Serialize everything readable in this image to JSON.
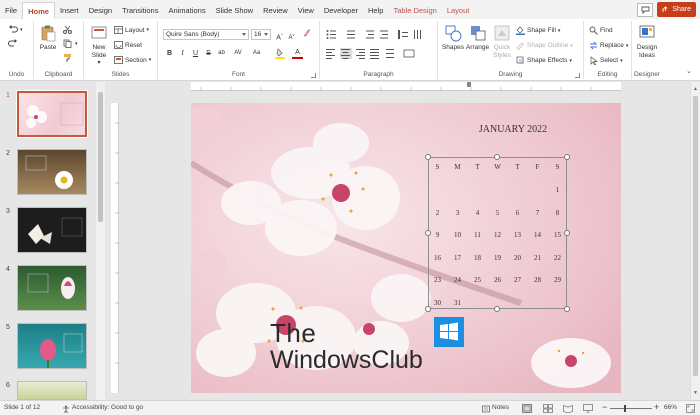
{
  "menu": {
    "tabs": [
      "File",
      "Home",
      "Insert",
      "Design",
      "Transitions",
      "Animations",
      "Slide Show",
      "Review",
      "View",
      "Developer",
      "Help"
    ],
    "context_tabs": [
      "Table Design",
      "Layout"
    ],
    "share": "Share"
  },
  "ribbon": {
    "undo_label": "Undo",
    "clipboard": {
      "label": "Clipboard",
      "paste": "Paste"
    },
    "slides": {
      "label": "Slides",
      "new_slide": "New Slide",
      "new_slide_arrow": "▾",
      "layout": "Layout",
      "reset": "Reset",
      "section": "Section"
    },
    "font": {
      "label": "Font",
      "family": "Quire Sans (Body)",
      "size": "16",
      "bold": "B",
      "italic": "I",
      "underline": "U",
      "strike": "S",
      "shadow": "ab",
      "spacing": "AV",
      "case": "Aa",
      "color_letter": "A"
    },
    "paragraph": {
      "label": "Paragraph"
    },
    "drawing": {
      "label": "Drawing",
      "shapes": "Shapes",
      "arrange": "Arrange",
      "quick_styles": "Quick Styles",
      "shape_fill": "Shape Fill",
      "shape_outline": "Shape Outline",
      "shape_effects": "Shape Effects"
    },
    "editing": {
      "label": "Editing",
      "find": "Find",
      "replace": "Replace",
      "select": "Select"
    },
    "designer": {
      "label": "Designer",
      "design_ideas": "Design Ideas"
    }
  },
  "thumbnails": [
    "1",
    "2",
    "3",
    "4",
    "5",
    "6"
  ],
  "slide": {
    "month_title": "JANUARY 2022",
    "weekdays": [
      "S",
      "M",
      "T",
      "W",
      "T",
      "F",
      "S"
    ],
    "weeks": [
      [
        "",
        "",
        "",
        "",
        "",
        "",
        "1"
      ],
      [
        "2",
        "3",
        "4",
        "5",
        "6",
        "7",
        "8"
      ],
      [
        "9",
        "10",
        "11",
        "12",
        "13",
        "14",
        "15"
      ],
      [
        "16",
        "17",
        "18",
        "19",
        "20",
        "21",
        "22"
      ],
      [
        "23",
        "24",
        "25",
        "26",
        "27",
        "28",
        "29"
      ],
      [
        "30",
        "31",
        "",
        "",
        "",
        "",
        ""
      ]
    ],
    "watermark_line1": "The",
    "watermark_line2": "WindowsClub"
  },
  "status": {
    "slide_info": "Slide 1 of 12",
    "accessibility": "Accessibility: Good to go",
    "notes": "Notes",
    "zoom": "66%"
  },
  "colors": {
    "accent": "#c43e1c",
    "active_tab": "#b7472a",
    "context_tab": "#c0504d",
    "selection": "#c55a3b"
  }
}
